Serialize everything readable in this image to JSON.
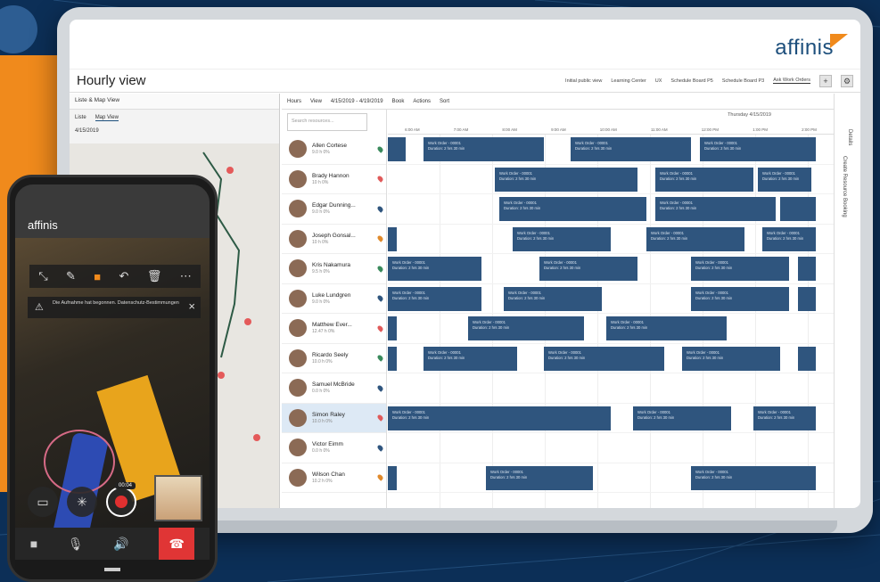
{
  "brand": "affinis",
  "page_title": "Hourly view",
  "header_nav": [
    "Initial public view",
    "Learning Center",
    "UX",
    "Schedule Board P5",
    "Schedule Board P3",
    "Ask Work Orders"
  ],
  "header_buttons": [
    "+",
    "⚙"
  ],
  "map_pane": {
    "title": "Liste & Map View",
    "tabs": [
      "Liste",
      "Map View"
    ],
    "date": "4/15/2019"
  },
  "toolbar": {
    "hours": "Hours",
    "view": "View",
    "date_range": "4/15/2019 - 4/19/2019",
    "book": "Book",
    "actions": "Actions",
    "sort": "Sort"
  },
  "search_placeholder": "Search resources...",
  "timeline_date": "Thursday  4/15/2019",
  "hours": [
    "6:00 AM",
    "7:00 AM",
    "8:00 AM",
    "9:00 AM",
    "10:00 AM",
    "11:00 AM",
    "12:00 PM",
    "1:00 PM",
    "2:00 PM"
  ],
  "details_label": "Details",
  "create_label": "Create Resource Booking",
  "resources": [
    {
      "name": "Allen Cortese",
      "sub": "9.0 h  0%"
    },
    {
      "name": "Brady Hannon",
      "sub": "10 h  0%"
    },
    {
      "name": "Edgar Dunning...",
      "sub": "9.0 h  0%"
    },
    {
      "name": "Joseph Gonsal...",
      "sub": "10 h  0%"
    },
    {
      "name": "Kris Nakamura",
      "sub": "9.5 h  0%"
    },
    {
      "name": "Luke Lundgren",
      "sub": "9.0 h  0%"
    },
    {
      "name": "Matthew Ever...",
      "sub": "12.47 h  0%"
    },
    {
      "name": "Ricardo Seely",
      "sub": "10.0 h  0%"
    },
    {
      "name": "Samuel McBride",
      "sub": "0.0 h  0%"
    },
    {
      "name": "Simon Raley",
      "sub": "10.0 h  0%"
    },
    {
      "name": "Victor Eimm",
      "sub": "0.0 h  0%"
    },
    {
      "name": "Wilson Chan",
      "sub": "10.2 h  0%"
    }
  ],
  "work_order_title": "Work Order - 00001",
  "duration": "Duration: 2 hrs 30 min",
  "phone": {
    "brand": "affinis",
    "banner": "Die Aufnahme hat begonnen. Datenschutz-Bestimmungen",
    "timer": "00:04"
  },
  "colors": {
    "accent": "#f08a1c",
    "navy": "#0c2f57",
    "booking": "#2f557e"
  }
}
